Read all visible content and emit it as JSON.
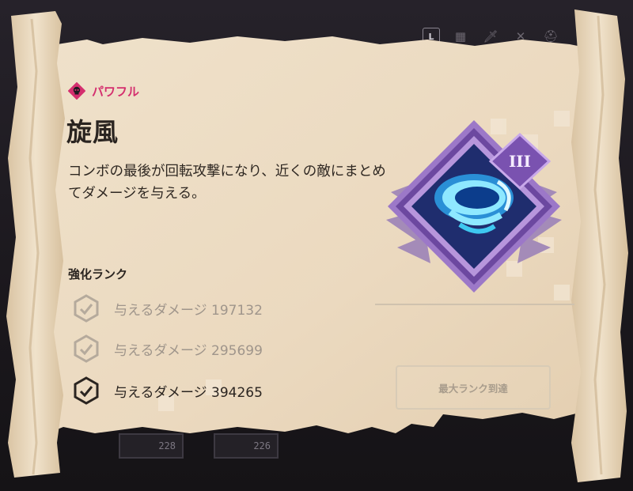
{
  "toolbar": {
    "key_label": "L",
    "icons": [
      "grid-icon",
      "sword-icon",
      "crossed-swords-icon",
      "helmet-icon",
      "flask-icon",
      "ring-icon"
    ]
  },
  "bottom_slots": [
    "228",
    "226"
  ],
  "enchant": {
    "category": "パワフル",
    "title": "旋風",
    "description": "コンボの最後が回転攻撃になり、近くの敵にまとめてダメージを与える。",
    "tier": "III",
    "rank_heading": "強化ランク",
    "ranks": [
      {
        "text": "与えるダメージ 197132",
        "active": false
      },
      {
        "text": "与えるダメージ 295699",
        "active": false
      },
      {
        "text": "与えるダメージ 394265",
        "active": true
      }
    ],
    "max_rank_label": "最大ランク到達"
  },
  "colors": {
    "parchment": "#ecdcc4",
    "category_accent": "#d42f6e",
    "emblem_purple": "#8a5cc4",
    "swirl_blue": "#3ec8f0"
  }
}
